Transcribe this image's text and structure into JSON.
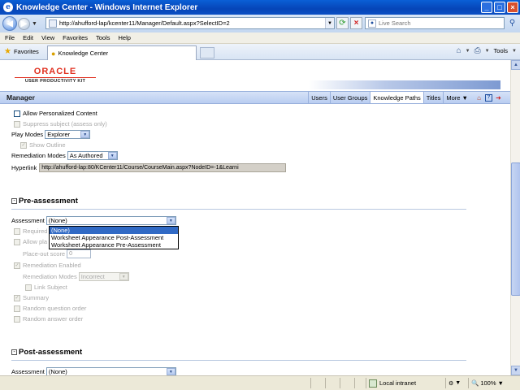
{
  "window": {
    "title": "Knowledge Center - Windows Internet Explorer",
    "minimize": "_",
    "maximize": "□",
    "close": "×"
  },
  "address": {
    "url": "http://ahufford-lap/kcenter11/Manager/Default.aspx?SelectID=2",
    "search_placeholder": "Live Search"
  },
  "menu": [
    "File",
    "Edit",
    "View",
    "Favorites",
    "Tools",
    "Help"
  ],
  "favbar": {
    "favorites_label": "Favorites",
    "tab_label": "Knowledge Center",
    "tools_label": "Tools"
  },
  "brand": {
    "oracle": "ORACLE",
    "product": "USER PRODUCTIVITY KIT"
  },
  "manager": {
    "title": "Manager",
    "nav": [
      "Users",
      "User Groups",
      "Knowledge Paths",
      "Titles",
      "More ▼"
    ],
    "active_nav": "Knowledge Paths"
  },
  "top_settings": {
    "allow_personalized": "Allow Personalized Content",
    "suppress_subject": "Suppress subject (assess only)",
    "play_modes_label": "Play Modes",
    "play_modes_value": "Explorer",
    "show_outline": "Show Outline",
    "remediation_modes_label": "Remediation Modes",
    "remediation_modes_value": "As Authored",
    "hyperlink_label": "Hyperlink",
    "hyperlink_value": "http://ahufford-lap:80/KCenter11/Course/CourseMain.aspx?NodeID=-1&Learni"
  },
  "pre_assessment": {
    "heading": "Pre-assessment",
    "assessment_label": "Assessment",
    "assessment_value": "(None)",
    "options": [
      "(None)",
      "Worksheet Appearance Post-Assessment",
      "Worksheet Appearance Pre-Assessment"
    ],
    "required": "Required",
    "allow_place_out": "Allow pla",
    "place_out_score_label": "Place-out score",
    "place_out_score_value": "0",
    "remediation_enabled": "Remediation Enabled",
    "remediation_modes_label": "Remediation Modes",
    "remediation_modes_value": "Incorrect",
    "link_subject": "Link Subject",
    "summary": "Summary",
    "random_question": "Random question order",
    "random_answer": "Random answer order"
  },
  "post_assessment": {
    "heading": "Post-assessment",
    "assessment_label": "Assessment",
    "assessment_value": "(None)"
  },
  "status": {
    "zone": "Local intranet",
    "zoom": "100%"
  }
}
